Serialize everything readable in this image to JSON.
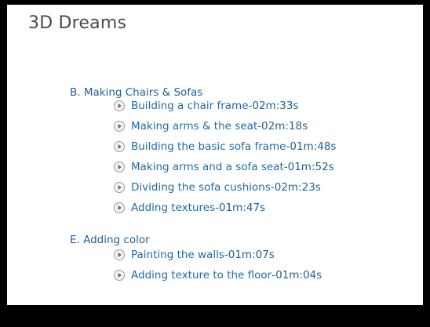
{
  "title": "3D Dreams",
  "sections": [
    {
      "label": "B. Making Chairs & Sofas",
      "lessons": [
        {
          "name": "Building a chair frame",
          "duration": "02m:33s"
        },
        {
          "name": "Making arms & the seat",
          "duration": "02m:18s"
        },
        {
          "name": "Building the basic sofa frame",
          "duration": "01m:48s"
        },
        {
          "name": "Making arms and a sofa seat",
          "duration": "01m:52s"
        },
        {
          "name": "Dividing the sofa cushions",
          "duration": "02m:23s"
        },
        {
          "name": "Adding textures",
          "duration": "01m:47s"
        }
      ]
    },
    {
      "label": "E. Adding color",
      "lessons": [
        {
          "name": "Painting the walls",
          "duration": "01m:07s"
        },
        {
          "name": "Adding texture to the floor",
          "duration": "01m:04s"
        }
      ]
    }
  ],
  "separator": " - ",
  "icons": {
    "lesson": "play-circle-icon"
  },
  "colors": {
    "link": "#1f6aa8",
    "title": "#4a4a4a",
    "frame": "#000000"
  }
}
